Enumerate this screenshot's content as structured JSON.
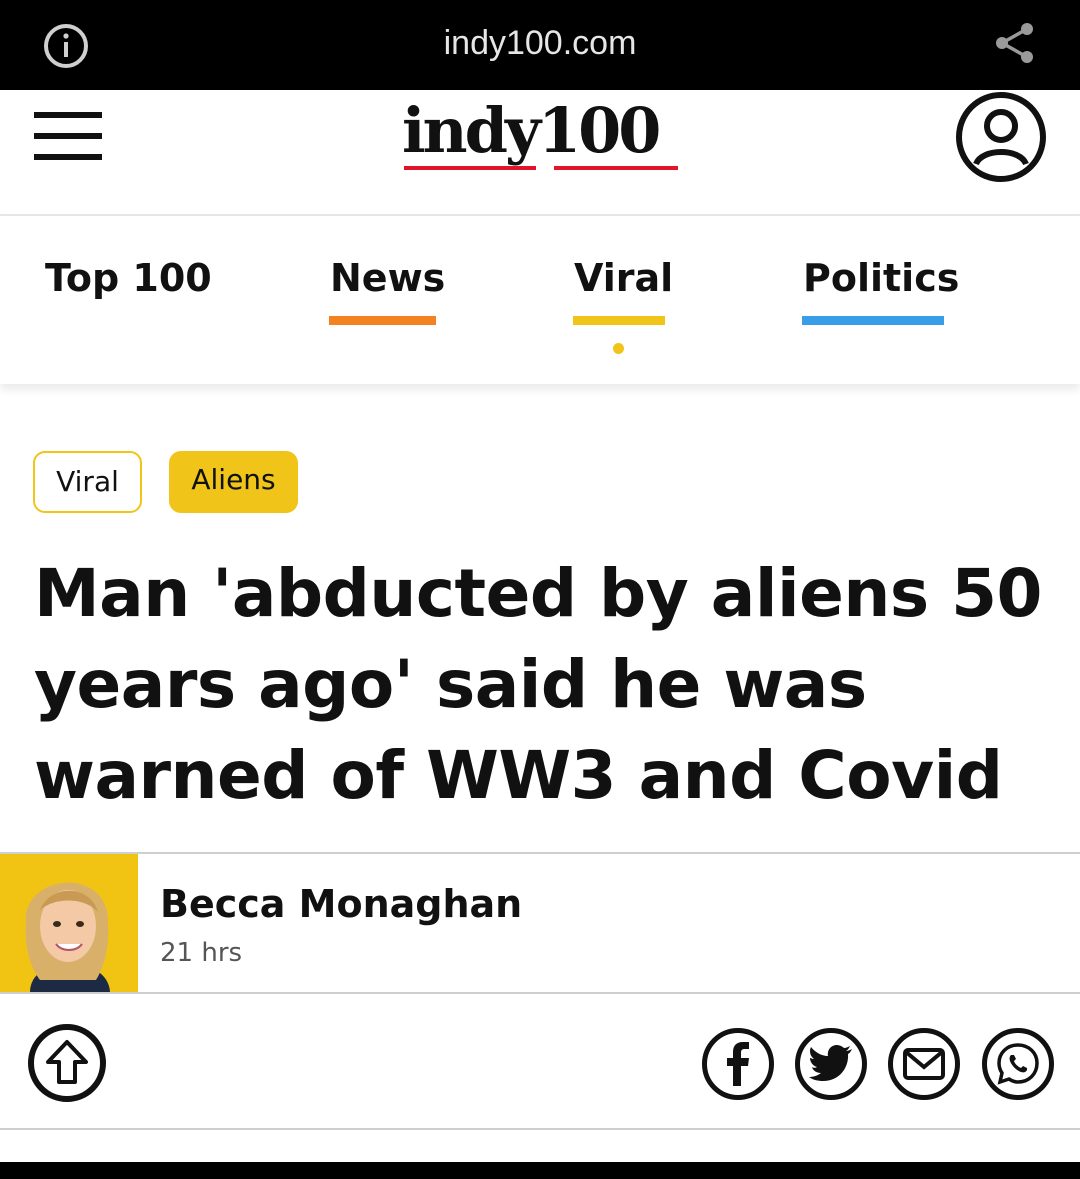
{
  "browser": {
    "url": "indy100.com",
    "info_icon": "info-icon",
    "share_icon": "share-icon"
  },
  "header": {
    "logo_text": "indy100",
    "menu_icon": "hamburger-menu-icon",
    "account_icon": "user-account-icon"
  },
  "nav": {
    "items": [
      {
        "label": "Top 100",
        "color": ""
      },
      {
        "label": "News",
        "color": "#f58220"
      },
      {
        "label": "Viral",
        "color": "#f0c419",
        "active": true
      },
      {
        "label": "Politics",
        "color": "#3a9de8"
      }
    ]
  },
  "article": {
    "tags": [
      "Viral",
      "Aliens"
    ],
    "headline": "Man 'abducted by aliens 50 years ago' said he was warned of WW3 and Covid",
    "author": "Becca Monaghan",
    "time": "21 hrs"
  },
  "share": {
    "icons": [
      "scroll-top-icon",
      "facebook-icon",
      "twitter-icon",
      "email-icon",
      "whatsapp-icon"
    ]
  },
  "colors": {
    "accent_yellow": "#f0c419",
    "accent_orange": "#f58220",
    "accent_blue": "#3a9de8",
    "logo_red": "#e0142b"
  }
}
